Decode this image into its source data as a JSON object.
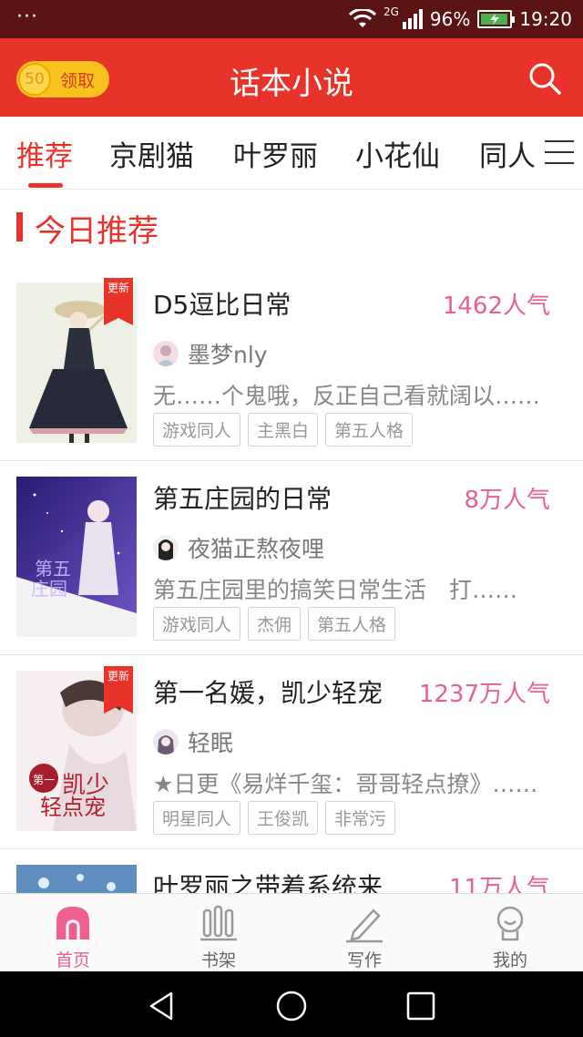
{
  "status_bar": {
    "dots": "···",
    "network": "2G",
    "battery": "96%",
    "time": "19:20"
  },
  "header": {
    "coin_value": "50",
    "coin_label": "领取",
    "title": "话本小说",
    "search_icon": "search-icon"
  },
  "tabs": [
    {
      "label": "推荐",
      "active": true
    },
    {
      "label": "京剧猫"
    },
    {
      "label": "叶罗丽"
    },
    {
      "label": "小花仙"
    },
    {
      "label": "同人"
    }
  ],
  "section": {
    "title": "今日推荐"
  },
  "books": [
    {
      "title": "D5逗比日常",
      "popularity": "1462人气",
      "author": "墨梦nly",
      "description": "无……个鬼哦，反正自己看就阔以……",
      "tags": [
        "游戏同人",
        "主黑白",
        "第五人格"
      ],
      "badge": "更新",
      "has_badge": true
    },
    {
      "title": "第五庄园的日常",
      "popularity": "8万人气",
      "author": "夜猫正熬夜哩",
      "description": "第五庄园里的搞笑日常生活　打……",
      "tags": [
        "游戏同人",
        "杰佣",
        "第五人格"
      ],
      "badge": "",
      "has_badge": false
    },
    {
      "title": "第一名媛，凯少轻宠",
      "popularity": "1237万人气",
      "author": "轻眠",
      "description": "★日更《易烊千玺：哥哥轻点撩》……",
      "tags": [
        "明星同人",
        "王俊凯",
        "非常污"
      ],
      "badge": "更新",
      "has_badge": true
    },
    {
      "title": "叶罗丽之带着系统来",
      "popularity": "11万人气",
      "author": "",
      "description": "",
      "tags": [],
      "badge": "",
      "has_badge": false
    }
  ],
  "bottom_nav": [
    {
      "label": "首页",
      "icon": "home-icon",
      "active": true
    },
    {
      "label": "书架",
      "icon": "bookshelf-icon"
    },
    {
      "label": "写作",
      "icon": "pen-icon"
    },
    {
      "label": "我的",
      "icon": "profile-icon"
    }
  ],
  "colors": {
    "brand_red": "#e8332a",
    "pink": "#ec5f8e",
    "status_bar": "#5a1414"
  }
}
